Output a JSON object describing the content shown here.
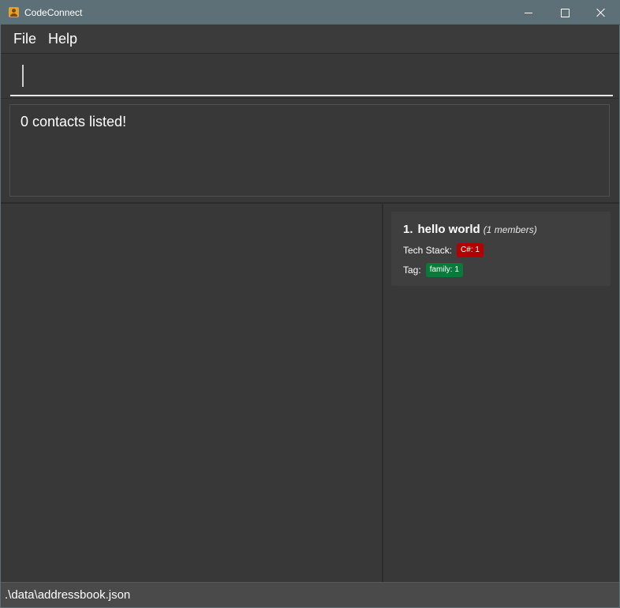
{
  "window": {
    "title": "CodeConnect",
    "accent": "#5d7078"
  },
  "menu": {
    "file_label": "File",
    "help_label": "Help"
  },
  "command": {
    "value": "",
    "placeholder": ""
  },
  "result": {
    "text": "0 contacts listed!"
  },
  "groups": [
    {
      "index": "1.",
      "name": "hello world",
      "members": "(1 members)",
      "tech_stack_label": "Tech Stack:",
      "tech_badges": [
        "C#: 1"
      ],
      "tag_label": "Tag:",
      "tag_badges": [
        "family: 1"
      ]
    }
  ],
  "status": {
    "path": ".\\data\\addressbook.json"
  },
  "colors": {
    "tech_badge": "#b30000",
    "tag_badge": "#0a7a3a",
    "background": "#383838"
  }
}
